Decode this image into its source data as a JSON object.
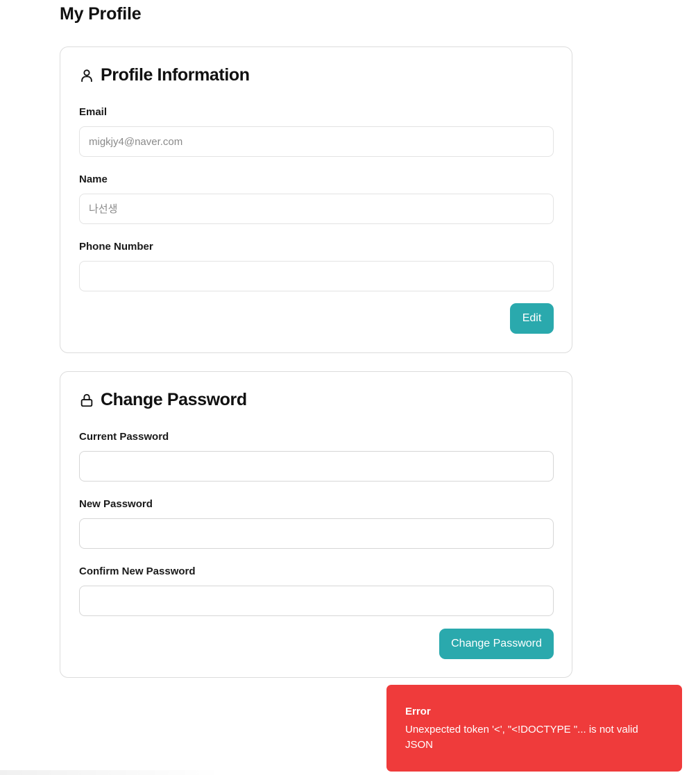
{
  "page": {
    "title": "My Profile"
  },
  "profile": {
    "header_icon": "user-icon",
    "title": "Profile Information",
    "email_label": "Email",
    "email_placeholder": "migkjy4@naver.com",
    "name_label": "Name",
    "name_placeholder": "나선생",
    "phone_label": "Phone Number",
    "phone_value": "",
    "edit_label": "Edit"
  },
  "password": {
    "header_icon": "lock-icon",
    "title": "Change Password",
    "current_label": "Current Password",
    "new_label": "New Password",
    "confirm_label": "Confirm New Password",
    "submit_label": "Change Password"
  },
  "toast": {
    "title": "Error",
    "message": "Unexpected token '<', \"<!DOCTYPE \"... is not valid JSON"
  },
  "colors": {
    "accent": "#2aa9ad",
    "error": "#ef3b3b",
    "border": "#dcdcdc"
  }
}
